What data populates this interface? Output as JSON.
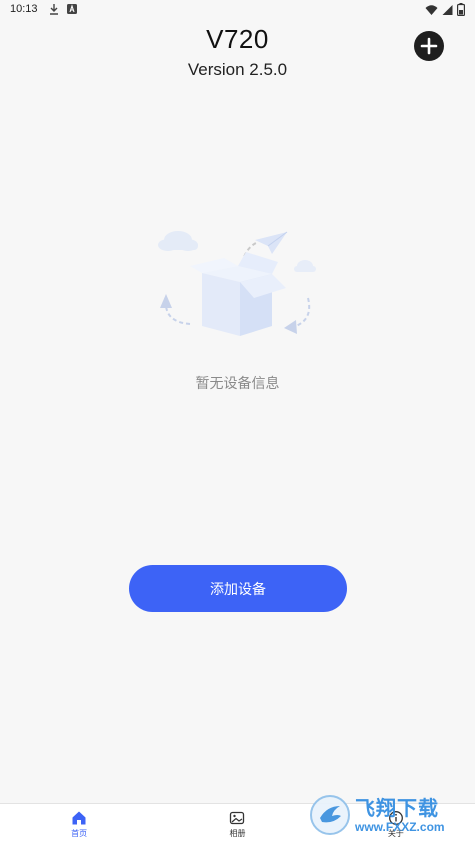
{
  "status_bar": {
    "time": "10:13",
    "left_icons": [
      "download-icon",
      "text-a-icon"
    ],
    "right_icons": [
      "wifi-icon",
      "signal-icon",
      "battery-icon"
    ]
  },
  "header": {
    "title": "V720",
    "version": "Version 2.5.0",
    "add_icon": "plus-circle-icon"
  },
  "empty_state": {
    "message": "暂无设备信息",
    "illustration": "empty-box-illustration"
  },
  "primary_action": {
    "label": "添加设备",
    "color": "#3d63f6"
  },
  "bottom_nav": {
    "items": [
      {
        "label": "首页",
        "icon": "home-icon",
        "active": true
      },
      {
        "label": "相册",
        "icon": "album-icon",
        "active": false
      },
      {
        "label": "关于",
        "icon": "info-icon",
        "active": false
      }
    ]
  },
  "watermark": {
    "brand_cn": "飞翔下载",
    "brand_en": "www.FXXZ.com"
  }
}
